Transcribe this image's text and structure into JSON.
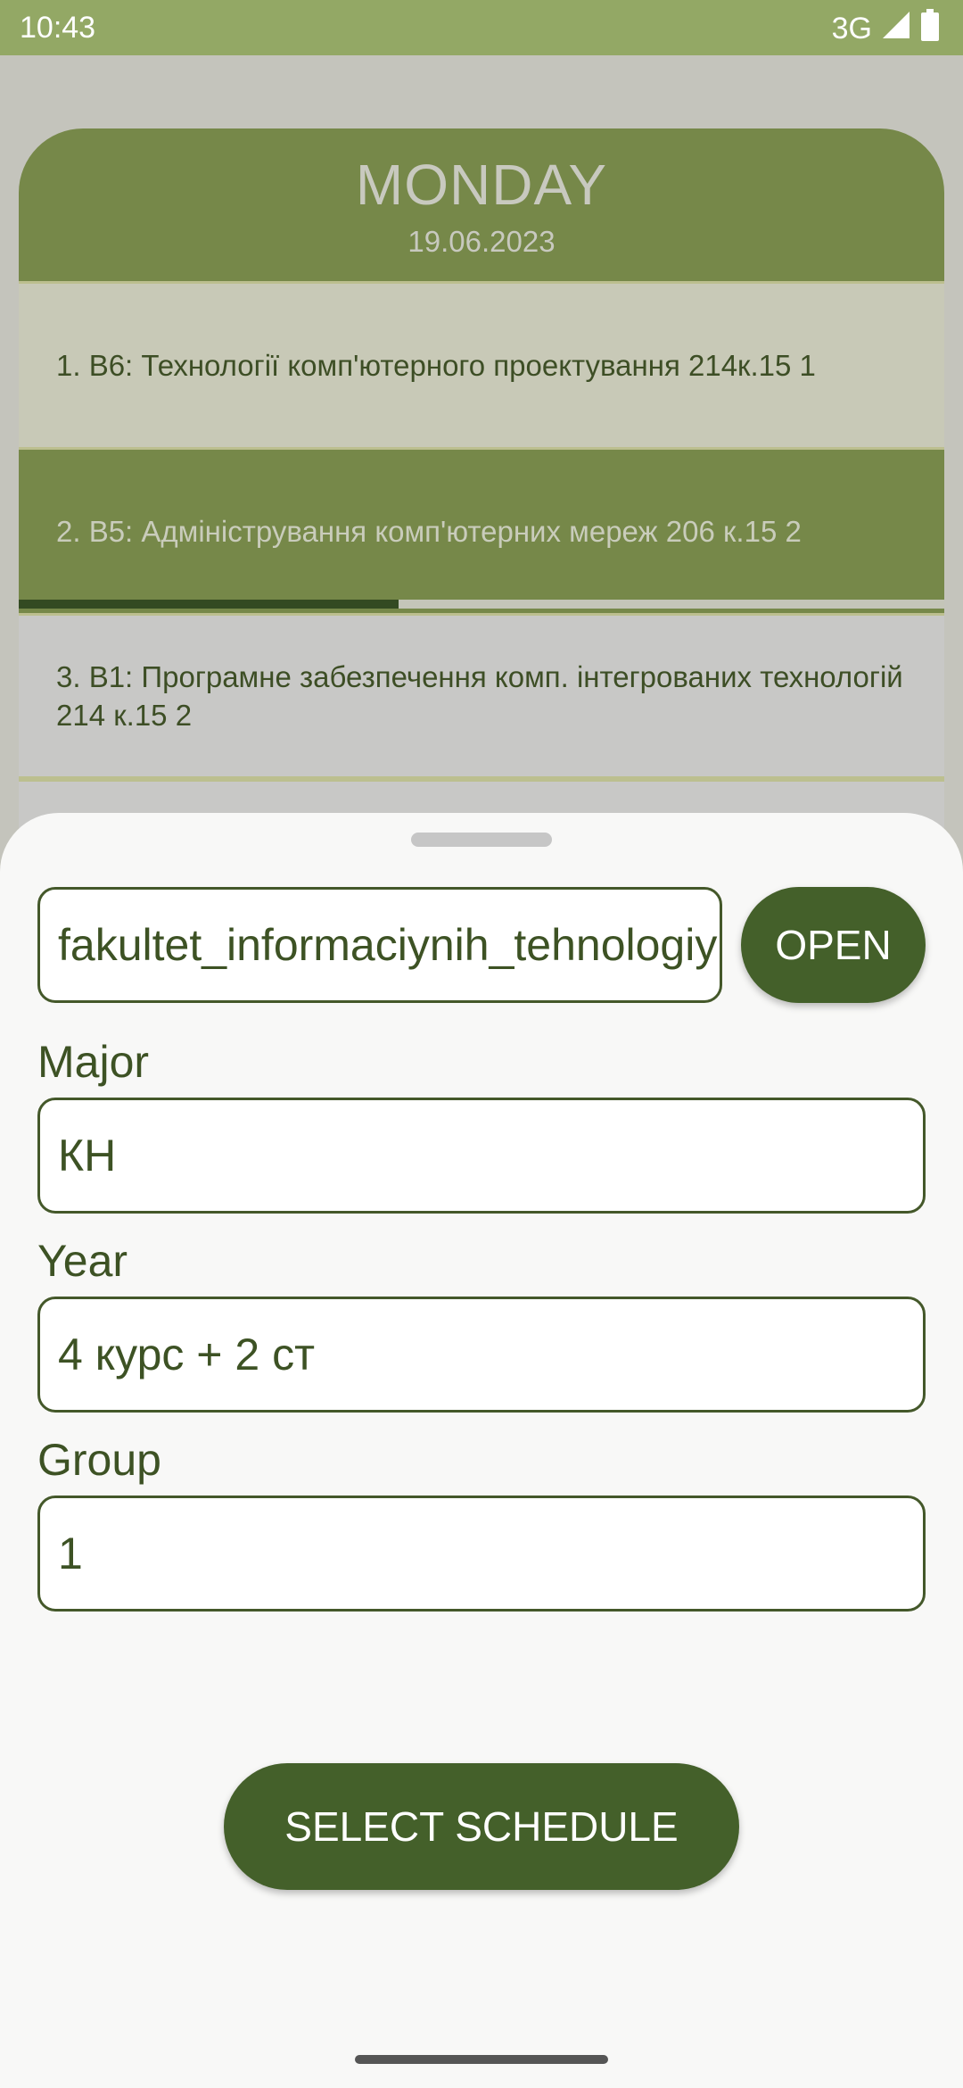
{
  "status_bar": {
    "time": "10:43",
    "network": "3G"
  },
  "schedule": {
    "day": "MONDAY",
    "date": "19.06.2023",
    "lessons": [
      "1. В6: Технології комп'ютерного проектування 214к.15 1",
      "2. В5: Адміністрування комп'ютерних мереж 206 к.15 2",
      "3. В1: Програмне забезпечення комп. інтегрованих технологій 214 к.15 2"
    ],
    "current_lesson_progress": 0.41
  },
  "sheet": {
    "faculty_value": "fakultet_informaciynih_tehnologiy",
    "open_label": "OPEN",
    "major_label": "Major",
    "major_value": "КН",
    "year_label": "Year",
    "year_value": "4 курс + 2 ст",
    "group_label": "Group",
    "group_value": "1",
    "select_label": "SELECT SCHEDULE"
  },
  "colors": {
    "accent": "#44602a",
    "header": "#768849",
    "status_bar": "#93a865",
    "sheet_bg": "#f8f8f7"
  }
}
